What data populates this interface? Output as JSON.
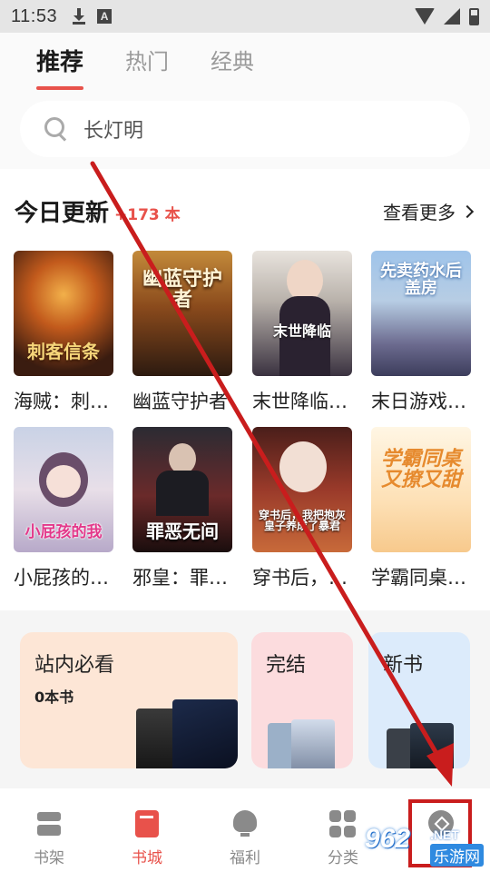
{
  "status_bar": {
    "time": "11:53",
    "icons": [
      "download-icon",
      "a-icon",
      "wifi-icon",
      "signal-icon",
      "battery-icon"
    ]
  },
  "tabs": [
    {
      "label": "推荐",
      "active": true
    },
    {
      "label": "热门",
      "active": false
    },
    {
      "label": "经典",
      "active": false
    }
  ],
  "search": {
    "text": "长灯明",
    "icon": "search-icon"
  },
  "today_update": {
    "title": "今日更新",
    "count": "173 本",
    "see_more": "查看更多",
    "books": [
      {
        "name": "海贼：刺…",
        "cover_title": "刺客信条"
      },
      {
        "name": "幽蓝守护者",
        "cover_title": "幽蓝守护者"
      },
      {
        "name": "末世降临…",
        "cover_title": "末世降临"
      },
      {
        "name": "末日游戏…",
        "cover_title": "先卖药水后盖房"
      },
      {
        "name": "小屁孩的…",
        "cover_title": "小屁孩的我"
      },
      {
        "name": "邪皇：罪…",
        "cover_title": "罪恶无间"
      },
      {
        "name": "穿书后，…",
        "cover_title": "穿书后，我把抱灰皇子养成了暴君"
      },
      {
        "name": "学霸同桌…",
        "cover_title": "学霸同桌又撩又甜"
      }
    ]
  },
  "categories": [
    {
      "title": "站内必看",
      "sub": "0本书",
      "color": "#fde6d6"
    },
    {
      "title": "完结",
      "sub": "",
      "color": "#fcdcde"
    },
    {
      "title": "新书",
      "sub": "",
      "color": "#dcebfb"
    }
  ],
  "bottom_nav": [
    {
      "label": "书架",
      "icon": "bookshelf-icon",
      "active": false
    },
    {
      "label": "书城",
      "icon": "book-icon",
      "active": true
    },
    {
      "label": "福利",
      "icon": "bulb-icon",
      "active": false
    },
    {
      "label": "分类",
      "icon": "category-grid-icon",
      "active": false
    },
    {
      "label": "",
      "icon": "compass-icon",
      "active": false
    }
  ],
  "watermark": {
    "number": "962",
    "suffix": ".NET",
    "site": "乐游网"
  },
  "colors": {
    "accent": "#e8524b",
    "annotation": "#c91d1d"
  }
}
